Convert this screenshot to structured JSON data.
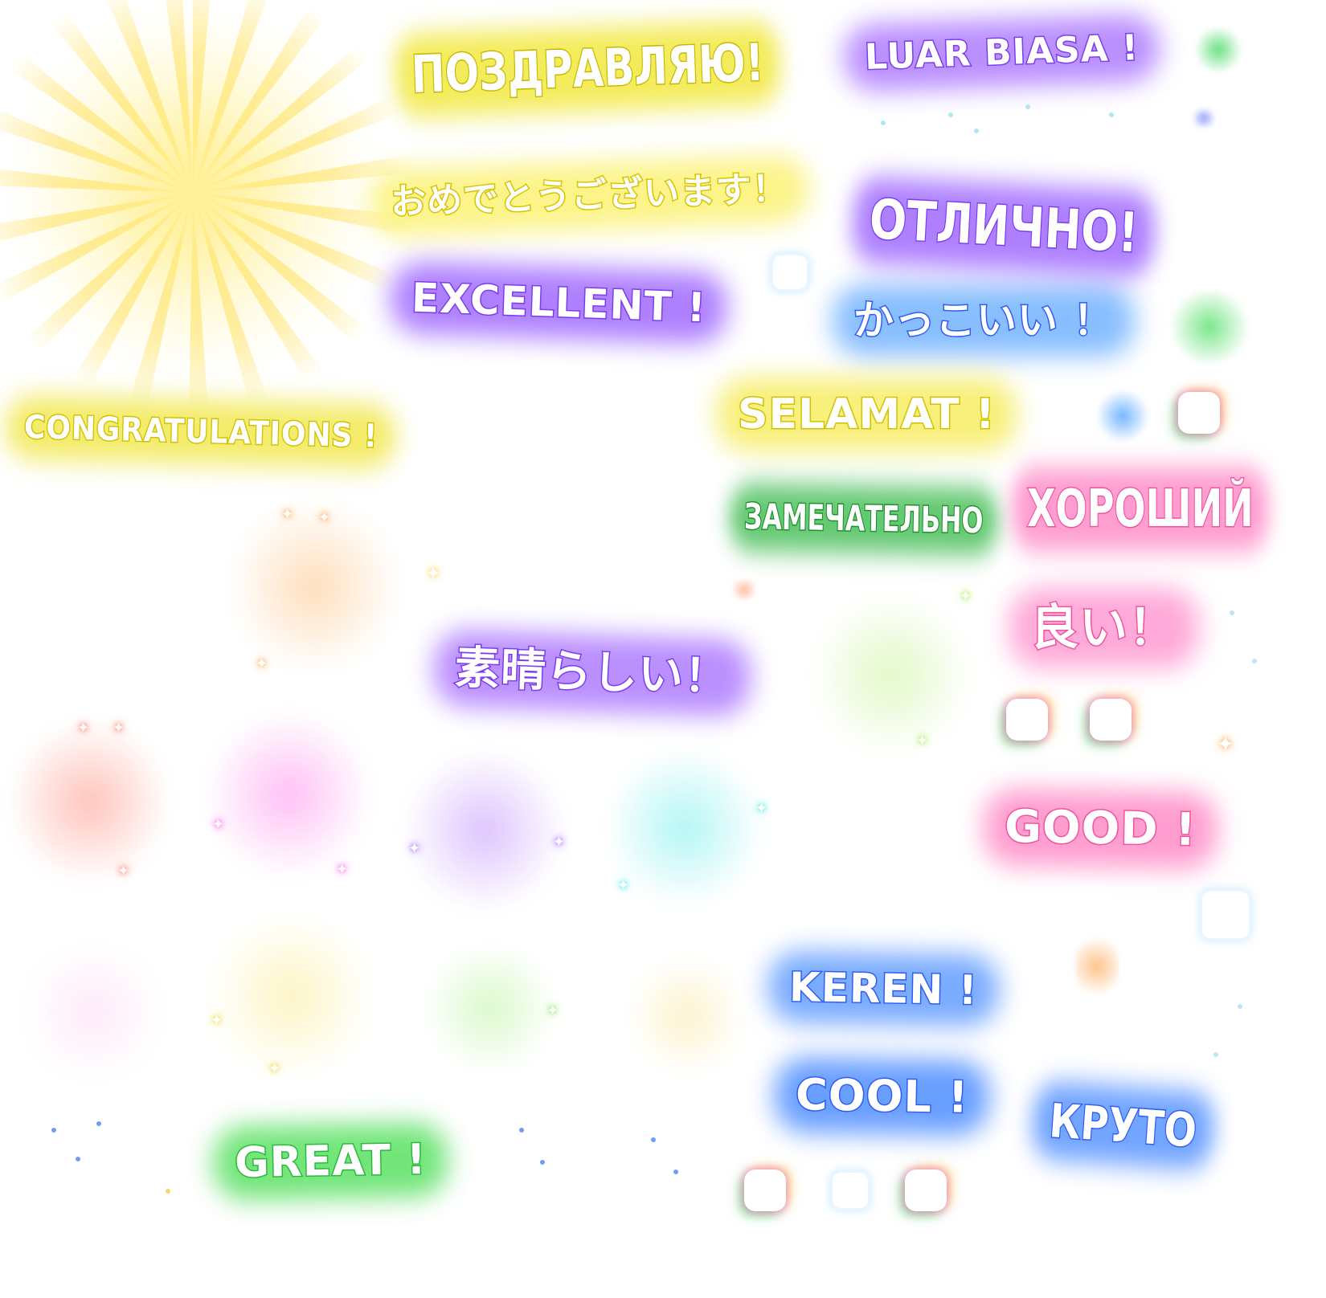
{
  "words": {
    "pozdravlyayu": "ПОЗДРАВЛЯЮ!",
    "luar_biasa": "LUAR BIASA !",
    "omedetou": "おめでとうございます！",
    "otlichno": "ОТЛИЧНО!",
    "excellent": "EXCELLENT !",
    "kakkoii": "かっこいい ！",
    "congratulations": "CONGRATULATIONS !",
    "selamat": "SELAMAT !",
    "zamechatelno": "ЗАМЕЧАТЕЛЬНО",
    "khoroshiy": "ХОРОШИЙ",
    "yoi": "良い！",
    "subarashii": "素晴らしい！",
    "good": "GOOD !",
    "keren": "KEREN !",
    "cool": "COOL !",
    "kruto": "КРУТО",
    "great": "GREAT !"
  },
  "colors": {
    "yellow": "#e6d21e",
    "purple": "#7b3cf0",
    "blue": "#2f5cf5",
    "green": "#29b83a",
    "pink": "#f2529c",
    "orange": "#ff9a3c",
    "red": "#ff6a50",
    "magenta": "#ff4fe0",
    "cyan": "#33e6e0",
    "lime": "#9be83a"
  },
  "icons": {
    "sunburst": "sunburst-icon",
    "sparkle": "sparkle-icon",
    "frame": "rainbow-frame-icon"
  }
}
